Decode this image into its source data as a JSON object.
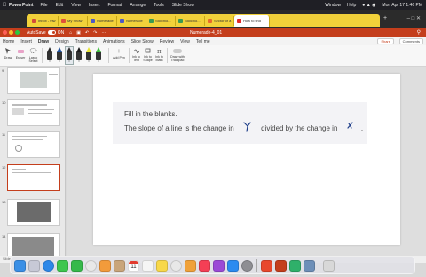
{
  "menubar": {
    "app_name": "PowerPoint",
    "items": [
      "File",
      "Edit",
      "View",
      "Insert",
      "Format",
      "Arrange",
      "Tools",
      "Slide Show"
    ],
    "right_items": [
      "Window",
      "Help"
    ],
    "clock": "Mon Apr 17  1:46 PM"
  },
  "browser_tabs": [
    {
      "label": "Inbox - thw",
      "color": "#d24b3b"
    },
    {
      "label": "My Show",
      "color": "#e0513a"
    },
    {
      "label": "Numerade",
      "color": "#4e59c5"
    },
    {
      "label": "Numerade",
      "color": "#4e59c5"
    },
    {
      "label": "Stoichio...",
      "color": "#3a9b52"
    },
    {
      "label": "Stoichio...",
      "color": "#3a9b52"
    },
    {
      "label": "Sector of a",
      "color": "#e86a2c"
    },
    {
      "label": "How to find",
      "color": "#e02a2a",
      "active": true
    }
  ],
  "titlebar": {
    "autosave_label": "AutoSave",
    "autosave_state": "ON",
    "doc_title": "Numerade-4_01",
    "accent": "#c43e1c"
  },
  "ribbon_tabs": [
    "Home",
    "Insert",
    "Draw",
    "Design",
    "Transitions",
    "Animations",
    "Slide Show",
    "Review",
    "View",
    "Tell me"
  ],
  "ribbon_active_tab": "Draw",
  "share_label": "Share",
  "comments_label": "Comments",
  "ribbon": {
    "draw_label": "Draw",
    "eraser_label": "Eraser",
    "lasso_label": "Lasso Select",
    "add_pen_label": "Add Pen",
    "ink_to_text_label": "Ink to Text",
    "ink_to_shape_label": "Ink to Shape",
    "ink_to_math_label": "Ink to Math",
    "draw_with_trackpad_label": "Draw with Trackpad",
    "pens": [
      {
        "color": "#2b2b2b"
      },
      {
        "color": "#1f4f9a"
      },
      {
        "color": "#2b2b2b",
        "selected": true
      },
      {
        "color": "#1a1a1a"
      },
      {
        "color": "#e7e533"
      },
      {
        "color": "#3fbf3f"
      }
    ]
  },
  "slides": [
    {
      "number": "9"
    },
    {
      "number": "10"
    },
    {
      "number": "11"
    },
    {
      "number": "12"
    },
    {
      "number": "13"
    },
    {
      "number": "14"
    },
    {
      "number": "15"
    }
  ],
  "slide": {
    "line1": "Fill in the blanks.",
    "line2_a": "The slope of a line is the change in",
    "line2_b": "divided by the change in",
    "line2_end": ".",
    "blank1_ink": "y",
    "blank2_ink": "x"
  },
  "statusbar": {
    "text": "Slide"
  },
  "dock_icons": [
    {
      "name": "finder",
      "color": "#3a8fe6"
    },
    {
      "name": "launchpad",
      "color": "#c7c9d6"
    },
    {
      "name": "safari",
      "color": "#2d88e8"
    },
    {
      "name": "messages",
      "color": "#3ec64e"
    },
    {
      "name": "facetime",
      "color": "#36b94a"
    },
    {
      "name": "chrome",
      "color": "#e8e8e8"
    },
    {
      "name": "photos",
      "color": "#f29b3b"
    },
    {
      "name": "contacts",
      "color": "#c9a57a"
    },
    {
      "name": "calendar",
      "color": "#ffffff",
      "text": "11"
    },
    {
      "name": "reminders",
      "color": "#f5f5f5"
    },
    {
      "name": "notes",
      "color": "#f8d84a"
    },
    {
      "name": "chrome-2",
      "color": "#e8e8e8"
    },
    {
      "name": "pages",
      "color": "#f0a13a"
    },
    {
      "name": "music",
      "color": "#f43f55"
    },
    {
      "name": "podcasts",
      "color": "#9b4ad6"
    },
    {
      "name": "app-store",
      "color": "#2c8bf0"
    },
    {
      "name": "system-preferences",
      "color": "#8e8e93"
    },
    {
      "name": "microsoft-office",
      "color": "#e8482c"
    },
    {
      "name": "powerpoint",
      "color": "#c43e1c"
    },
    {
      "name": "webex",
      "color": "#2fb06a"
    },
    {
      "name": "preview",
      "color": "#6d8fb8"
    },
    {
      "name": "trash",
      "color": "#d8d8d8"
    }
  ]
}
